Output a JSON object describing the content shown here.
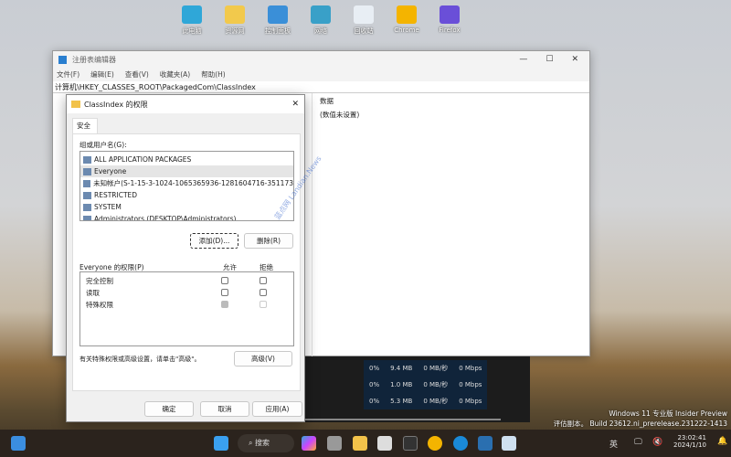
{
  "desktop": {
    "icons": [
      {
        "label": "此电脑",
        "color": "#2fa7d8"
      },
      {
        "label": "资源网",
        "color": "#f2c94c"
      },
      {
        "label": "控制面板",
        "color": "#3a8fd8"
      },
      {
        "label": "网络",
        "color": "#39a0c8"
      },
      {
        "label": "回收站",
        "color": "#e8eef4"
      },
      {
        "label": "Chrome",
        "color": "#f4b400"
      },
      {
        "label": "Firefox",
        "color": "#6a4fd8"
      }
    ]
  },
  "regedit": {
    "title": "注册表编辑器",
    "menu": [
      "文件(F)",
      "编辑(E)",
      "查看(V)",
      "收藏夹(A)",
      "帮助(H)"
    ],
    "address": "计算机\\HKEY_CLASSES_ROOT\\PackagedCom\\ClassIndex",
    "col_data": "数据",
    "value_data": "(数值未设置)"
  },
  "dialog": {
    "title": "ClassIndex 的权限",
    "tab": "安全",
    "group_label": "组或用户名(G):",
    "users": [
      "ALL APPLICATION PACKAGES",
      "Everyone",
      "未知帐户(S-1-15-3-1024-1065365936-1281604716-351173",
      "RESTRICTED",
      "SYSTEM",
      "Administrators (DESKTOP\\Administrators)"
    ],
    "selected_user": "Everyone",
    "add": "添加(D)...",
    "remove": "删除(R)",
    "perm_label": "Everyone 的权限(P)",
    "allow": "允许",
    "deny": "拒绝",
    "perms": [
      {
        "name": "完全控制",
        "allow": false,
        "deny": false
      },
      {
        "name": "读取",
        "allow": false,
        "deny": false
      },
      {
        "name": "特殊权限",
        "allow": true,
        "deny": false,
        "disabled": true
      }
    ],
    "note": "有关特殊权限或高级设置，请单击\"高级\"。",
    "advanced": "高级(V)",
    "ok": "确定",
    "cancel": "取消",
    "apply": "应用(A)"
  },
  "taskmgr": {
    "rows": [
      [
        "0%",
        "9.4 MB",
        "0 MB/秒",
        "0 Mbps"
      ],
      [
        "0%",
        "1.0 MB",
        "0 MB/秒",
        "0 Mbps"
      ],
      [
        "0%",
        "5.3 MB",
        "0 MB/秒",
        "0 Mbps"
      ]
    ]
  },
  "watermark": {
    "line1": "Windows 11 专业版 Insider Preview",
    "line2": "评估副本。 Build 23612.ni_prerelease.231222-1413",
    "site": "蓝点网 Landian.News"
  },
  "taskbar": {
    "search": "搜索",
    "ime": "英",
    "time": "23:02:41",
    "date": "2024/1/10"
  }
}
